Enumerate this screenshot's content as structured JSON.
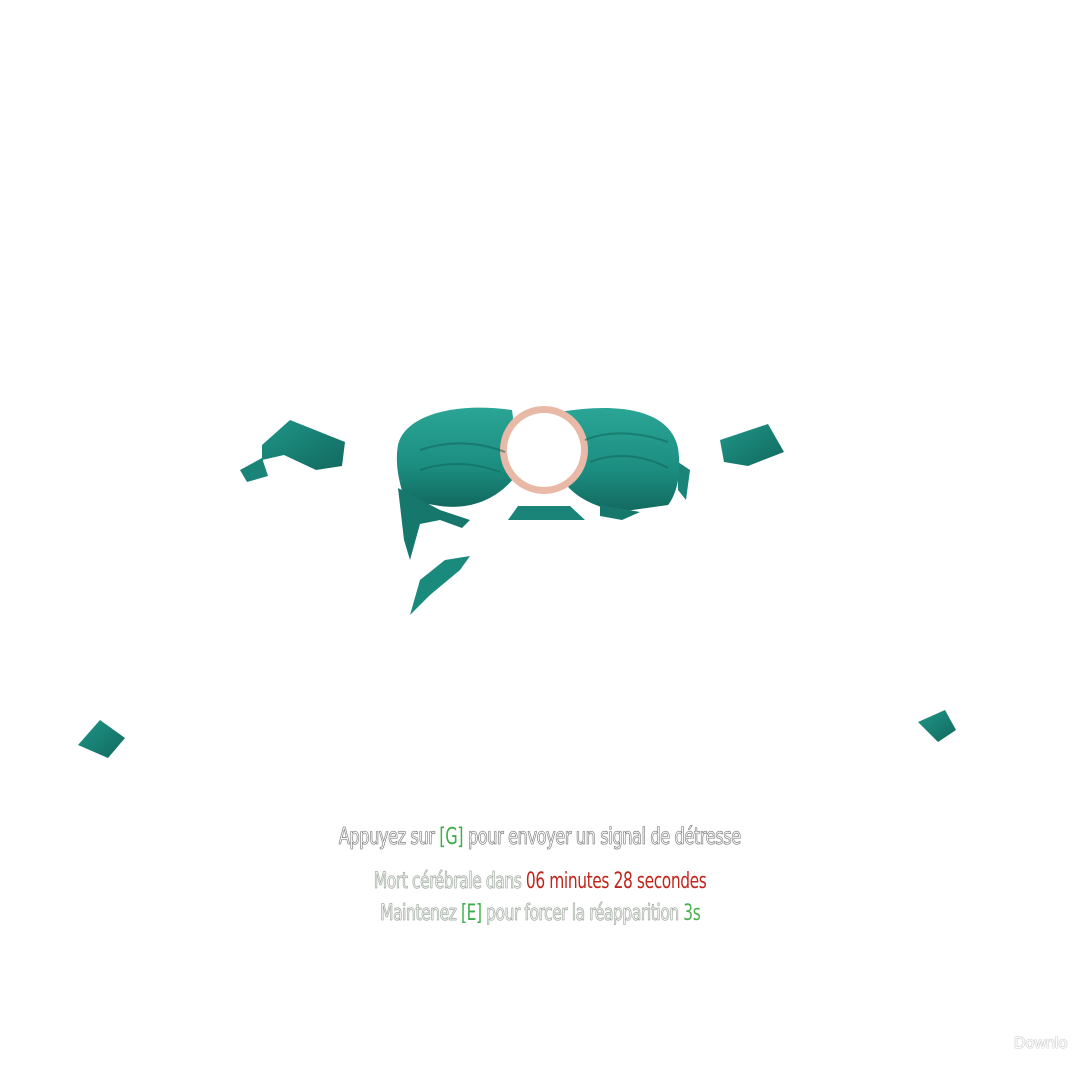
{
  "scene": {
    "garment_color": "#1f9688",
    "garment_shadow": "#12695f",
    "ring_color": "#e8b9a6"
  },
  "hud": {
    "distress": {
      "prefix": "Appuyez sur ",
      "key": "[G]",
      "suffix": " pour envoyer un signal de détresse"
    },
    "death": {
      "prefix": "Mort cérébrale dans ",
      "timer": "06 minutes 28 secondes"
    },
    "respawn": {
      "prefix": "Maintenez ",
      "key": "[E]",
      "middle": " pour forcer la réapparition ",
      "hold": "3s"
    },
    "key_color": "#3fae4a",
    "timer_color": "#c0261c"
  },
  "watermark": {
    "text": "Downlo"
  }
}
